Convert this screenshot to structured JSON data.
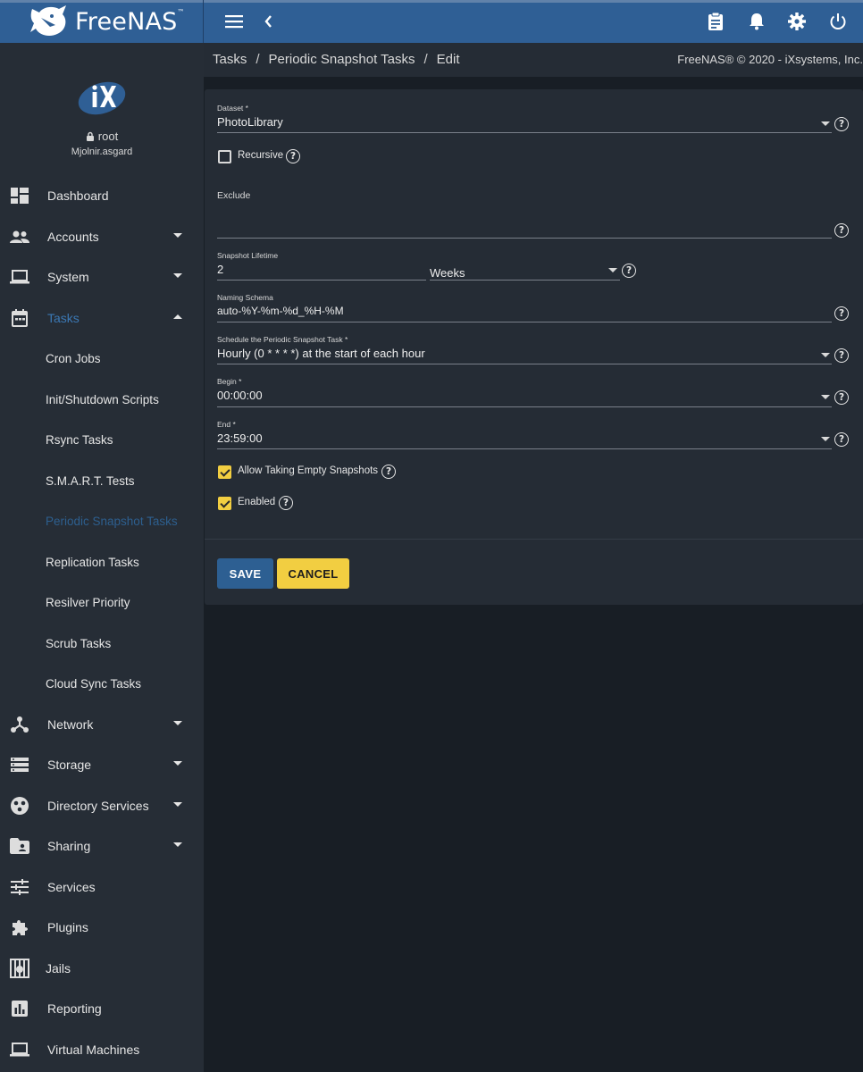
{
  "brand": {
    "name": "FreeNAS",
    "tm": "™"
  },
  "user": {
    "name": "root",
    "host": "Mjolnir.asgard"
  },
  "sidebar": {
    "items": [
      {
        "label": "Dashboard",
        "icon": "dashboard-icon"
      },
      {
        "label": "Accounts",
        "icon": "accounts-icon"
      },
      {
        "label": "System",
        "icon": "system-icon"
      },
      {
        "label": "Tasks",
        "icon": "calendar-icon"
      },
      {
        "label": "Network",
        "icon": "network-icon"
      },
      {
        "label": "Storage",
        "icon": "storage-icon"
      },
      {
        "label": "Directory Services",
        "icon": "directory-services-icon"
      },
      {
        "label": "Sharing",
        "icon": "sharing-icon"
      },
      {
        "label": "Services",
        "icon": "services-icon"
      },
      {
        "label": "Plugins",
        "icon": "plugins-icon"
      },
      {
        "label": "Jails",
        "icon": "jails-icon"
      },
      {
        "label": "Reporting",
        "icon": "reporting-icon"
      },
      {
        "label": "Virtual Machines",
        "icon": "virtual-machines-icon"
      }
    ],
    "tasks_sub": [
      "Cron Jobs",
      "Init/Shutdown Scripts",
      "Rsync Tasks",
      "S.M.A.R.T. Tests",
      "Periodic Snapshot Tasks",
      "Replication Tasks",
      "Resilver Priority",
      "Scrub Tasks",
      "Cloud Sync Tasks"
    ]
  },
  "breadcrumb": {
    "c1": "Tasks",
    "c2": "Periodic Snapshot Tasks",
    "c3": "Edit",
    "sep": "/"
  },
  "copyright": "FreeNAS® © 2020 - iXsystems, Inc.",
  "form": {
    "dataset": {
      "label": "Dataset *",
      "value": "PhotoLibrary"
    },
    "recursive": {
      "label": "Recursive",
      "checked": false
    },
    "exclude": {
      "label": "Exclude",
      "value": ""
    },
    "lifetime": {
      "label": "Snapshot Lifetime",
      "value": "2",
      "unit": "Weeks"
    },
    "naming": {
      "label": "Naming Schema",
      "value": "auto-%Y-%m-%d_%H-%M"
    },
    "schedule": {
      "label": "Schedule the Periodic Snapshot Task *",
      "value": "Hourly (0 * * * *) at the start of each hour"
    },
    "begin": {
      "label": "Begin *",
      "value": "00:00:00"
    },
    "end": {
      "label": "End *",
      "value": "23:59:00"
    },
    "allow_empty": {
      "label": "Allow Taking Empty Snapshots",
      "checked": true
    },
    "enabled": {
      "label": "Enabled",
      "checked": true
    },
    "help_glyph": "?",
    "save_label": "SAVE",
    "cancel_label": "CANCEL"
  },
  "colors": {
    "topbar": "#2f5f95",
    "accent_yellow": "#f2ce41",
    "sidebar_bg": "#262d36",
    "active_link": "#2d5f8f"
  }
}
